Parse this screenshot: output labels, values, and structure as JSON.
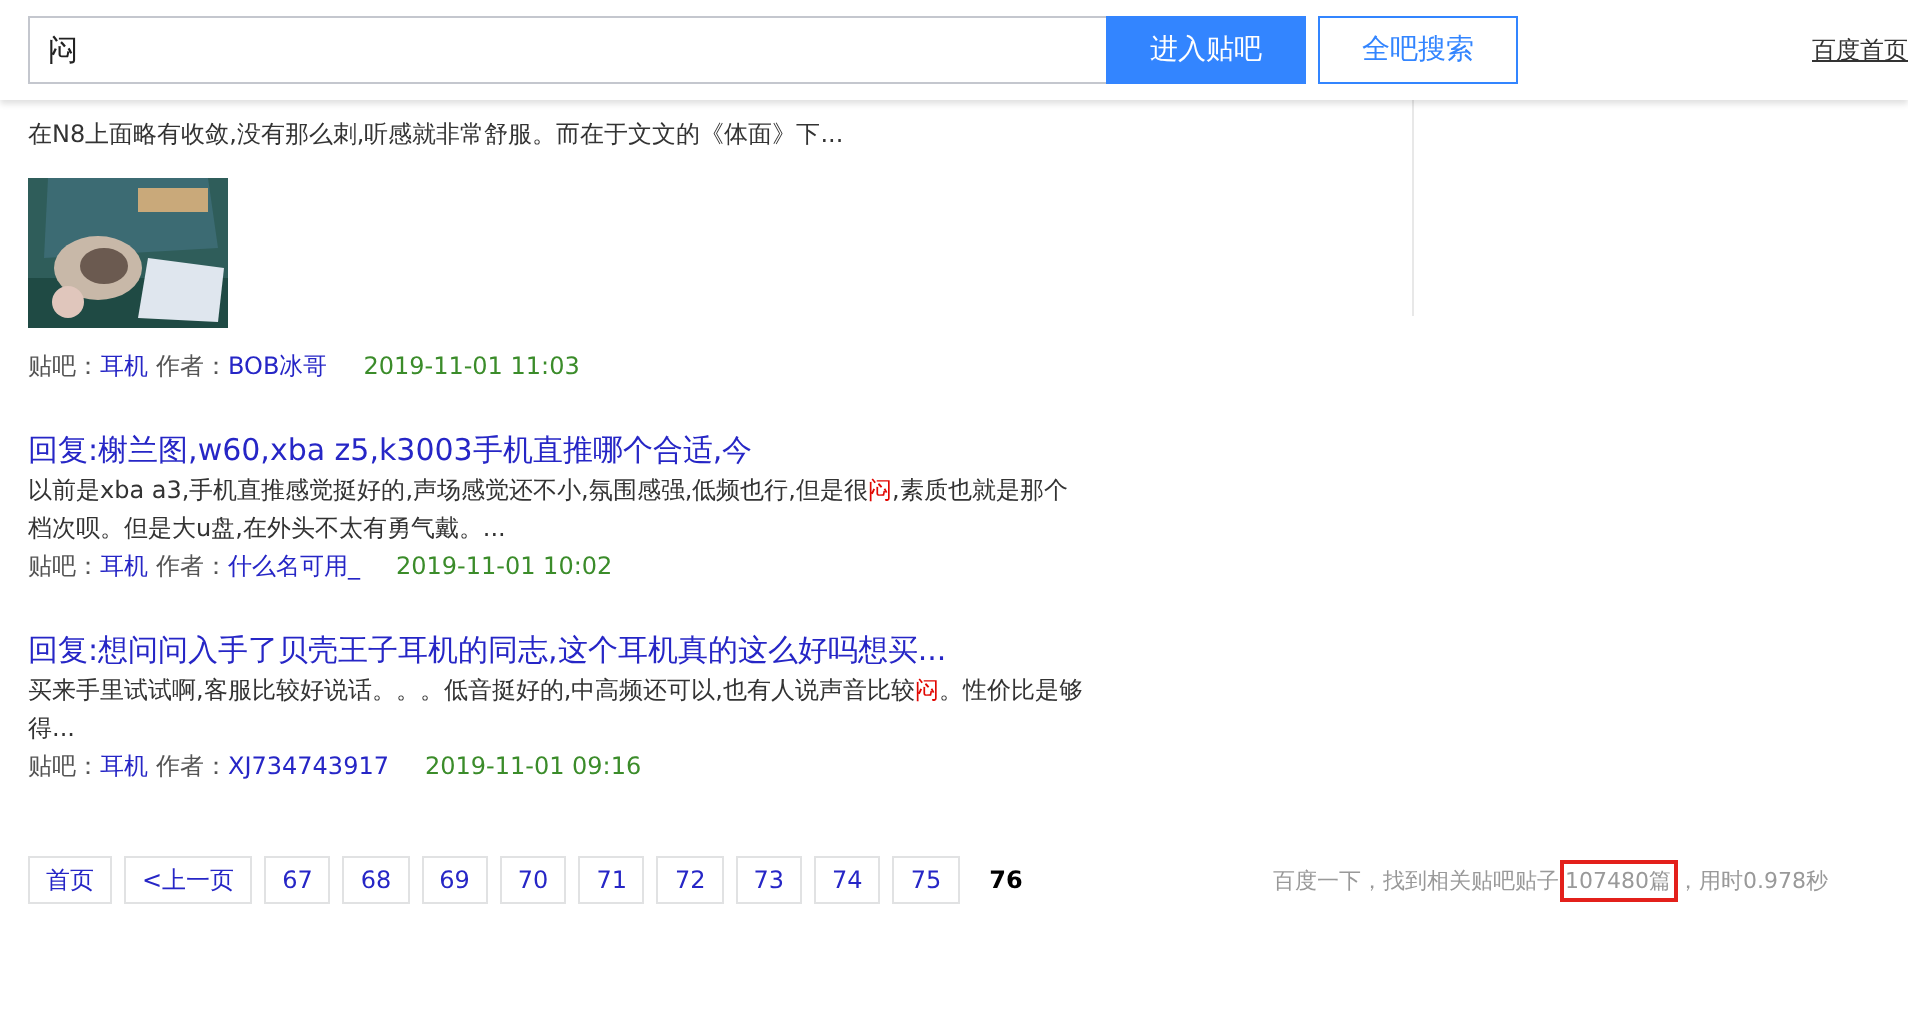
{
  "header": {
    "search_value": "闷",
    "enter_button": "进入贴吧",
    "search_all_button": "全吧搜索",
    "home_link": "百度首页"
  },
  "results": [
    {
      "snippet": [
        {
          "text": "在N8上面略有收敛,没有那么刺,听感就非常舒服。而在于文文的《体面》下...",
          "highlight": false
        }
      ],
      "has_picture": true,
      "forum_label": "贴吧：",
      "forum": "耳机",
      "author_label": "作者：",
      "author": "BOB冰哥",
      "date": "2019-11-01 11:03"
    },
    {
      "title": "回复:榭兰图,w60,xba z5,k3003手机直推哪个合适,今",
      "snippet": [
        {
          "text": "以前是xba a3,手机直推感觉挺好的,声场感觉还不小,氛围感强,低频也行,但是很",
          "highlight": false
        },
        {
          "text": "闷",
          "highlight": true
        },
        {
          "text": ",素质也就是那个档次呗。但是大u盘,在外头不太有勇气戴。...",
          "highlight": false
        }
      ],
      "has_picture": false,
      "forum_label": "贴吧：",
      "forum": "耳机",
      "author_label": "作者：",
      "author": "什么名可用_",
      "date": "2019-11-01 10:02"
    },
    {
      "title": "回复:想问问入手了贝壳王子耳机的同志,这个耳机真的这么好吗想买...",
      "snippet": [
        {
          "text": "买来手里试试啊,客服比较好说话。。。低音挺好的,中高频还可以,也有人说声音比较",
          "highlight": false
        },
        {
          "text": "闷",
          "highlight": true
        },
        {
          "text": "。性价比是够得...",
          "highlight": false
        }
      ],
      "has_picture": false,
      "forum_label": "贴吧：",
      "forum": "耳机",
      "author_label": "作者：",
      "author": "XJ734743917",
      "date": "2019-11-01 09:16"
    }
  ],
  "pagination": [
    {
      "label": "首页",
      "selected": false
    },
    {
      "label": "<上一页",
      "selected": false
    },
    {
      "label": "67",
      "selected": false
    },
    {
      "label": "68",
      "selected": false
    },
    {
      "label": "69",
      "selected": false
    },
    {
      "label": "70",
      "selected": false
    },
    {
      "label": "71",
      "selected": false
    },
    {
      "label": "72",
      "selected": false
    },
    {
      "label": "73",
      "selected": false
    },
    {
      "label": "74",
      "selected": false
    },
    {
      "label": "75",
      "selected": false
    },
    {
      "label": "76",
      "selected": true
    }
  ],
  "stats": {
    "prefix": "百度一下，找到相关贴吧贴子",
    "count": "107480篇",
    "count_boxed": true,
    "suffix": "，用时0.978秒"
  }
}
